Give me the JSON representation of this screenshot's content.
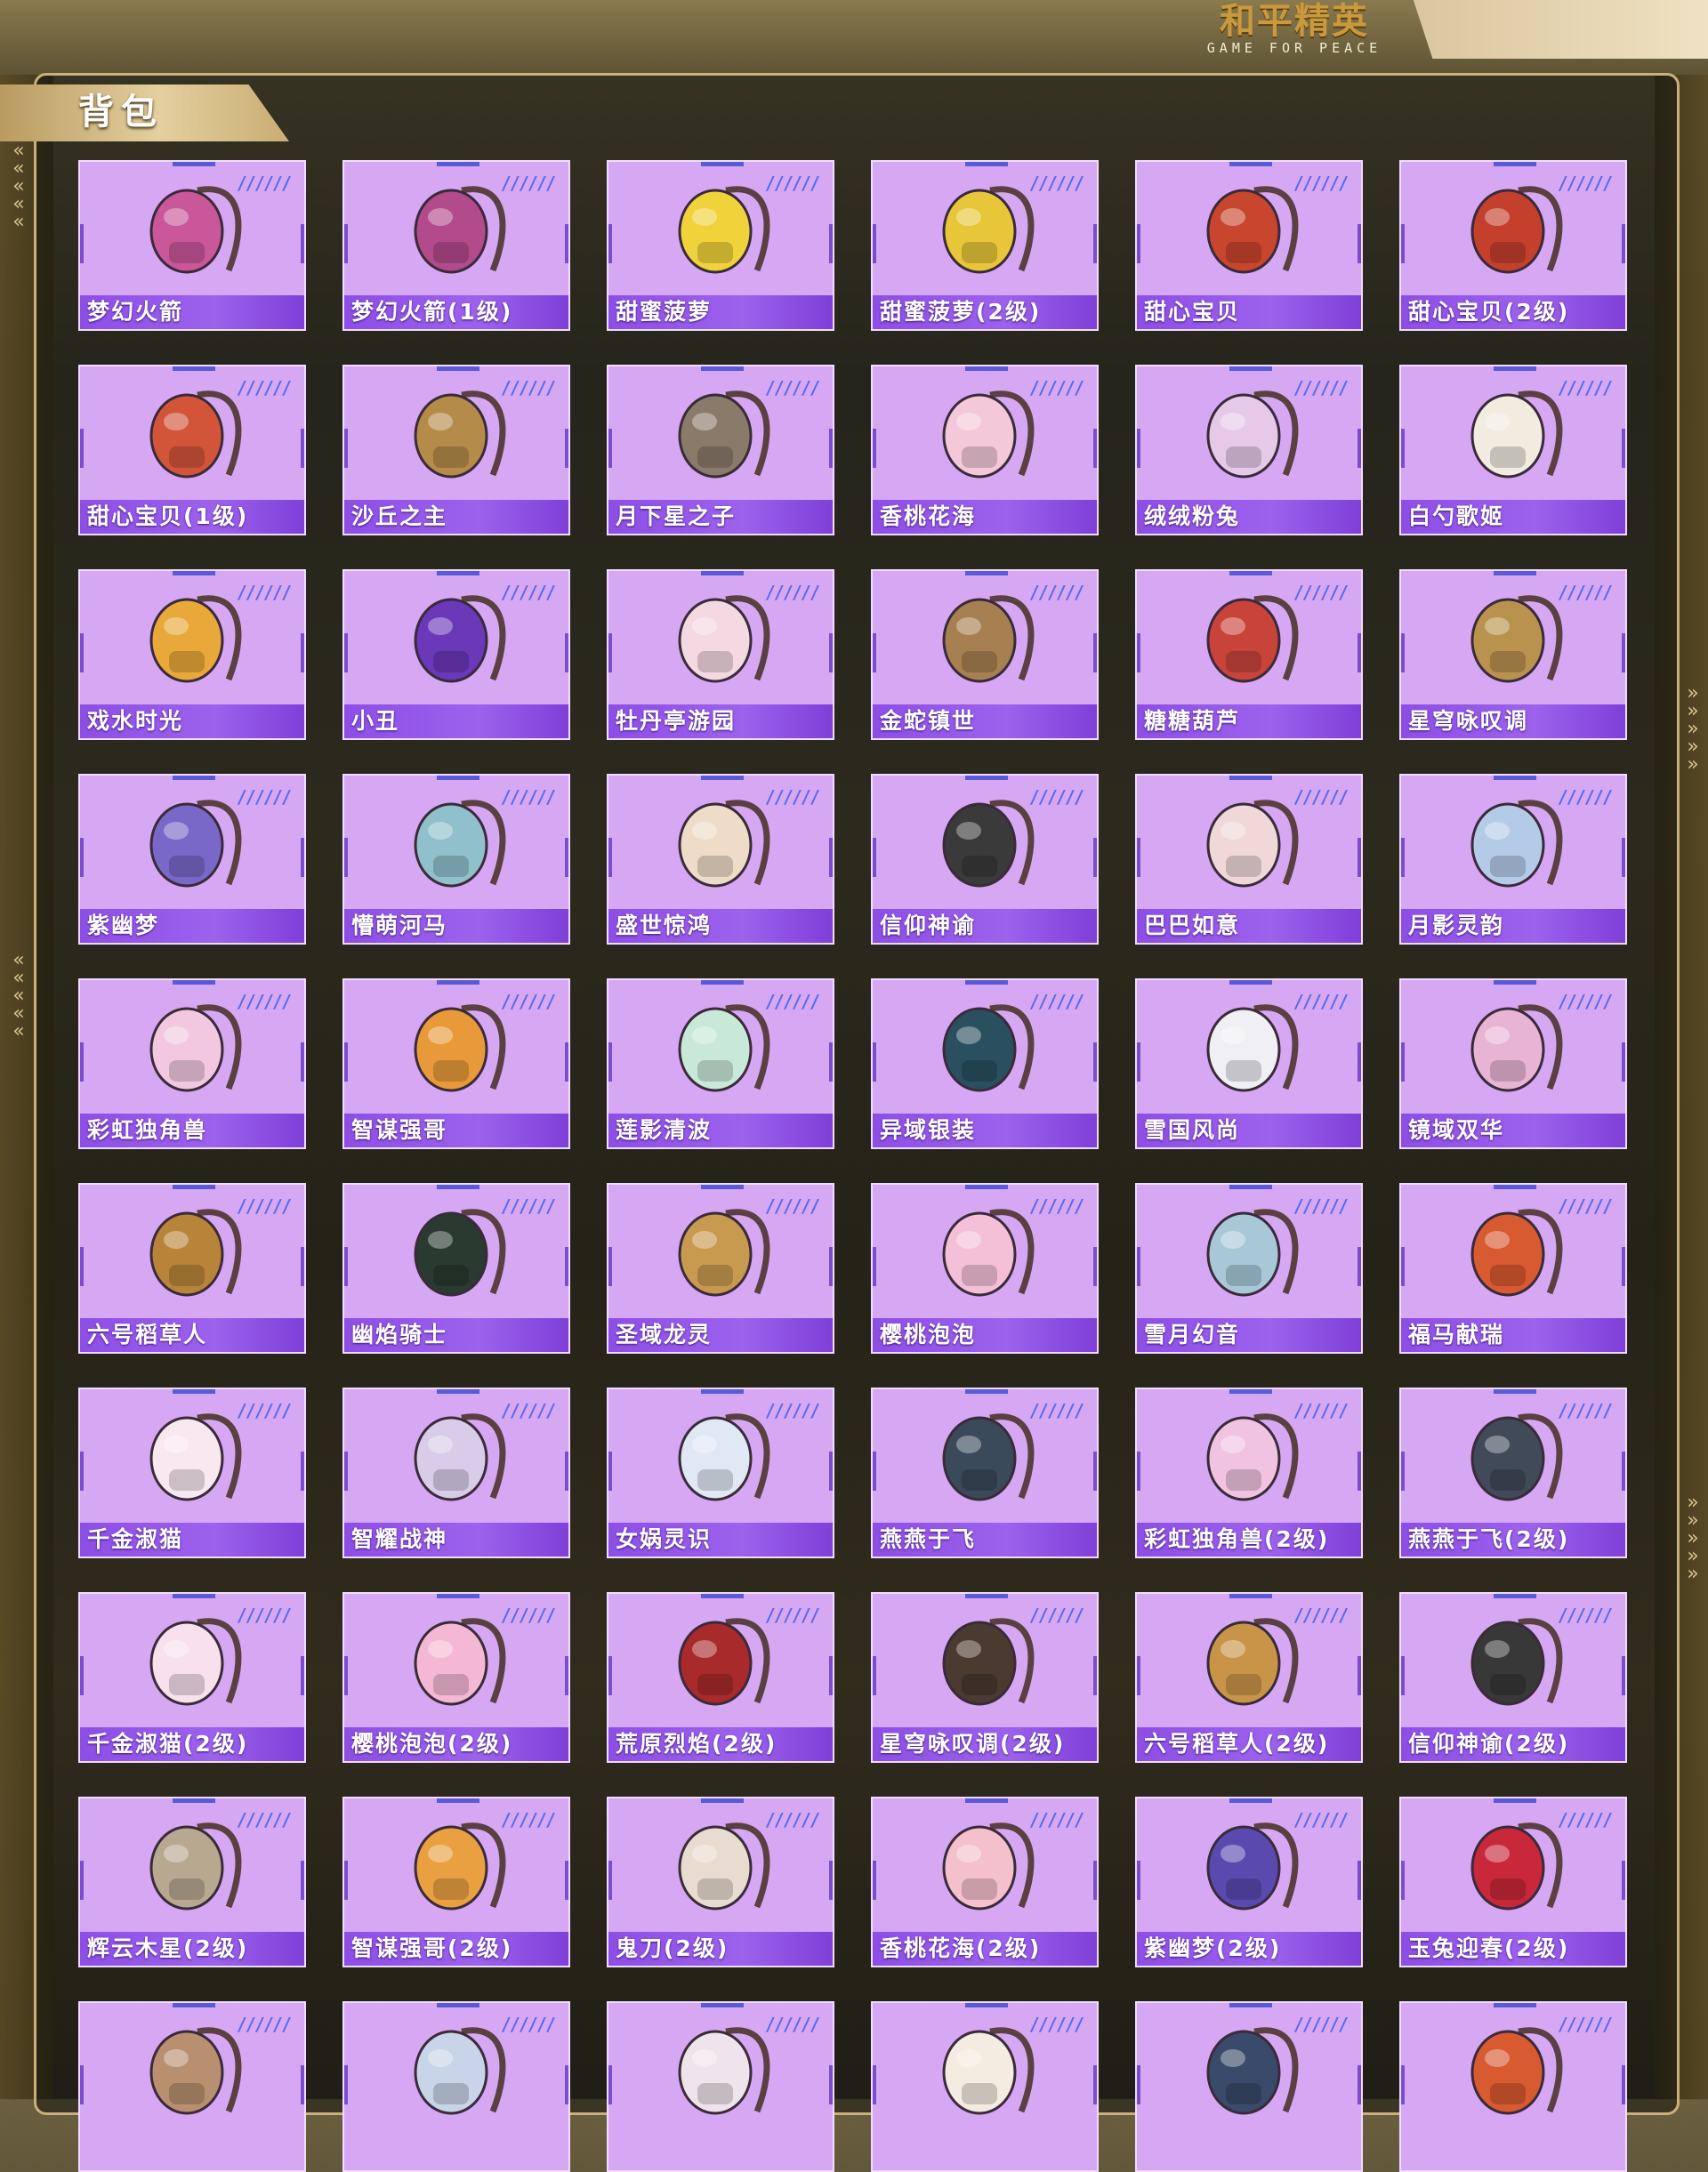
{
  "brand": {
    "title": "和平精英",
    "subtitle": "GAME FOR PEACE"
  },
  "section": {
    "title": "背包"
  },
  "items": [
    {
      "name": "梦幻火箭",
      "icon": "rocket-backpack-icon",
      "color": "#c9579a"
    },
    {
      "name": "梦幻火箭(1级)",
      "icon": "rocket-backpack-icon",
      "color": "#b24a8c"
    },
    {
      "name": "甜蜜菠萝",
      "icon": "pineapple-backpack-icon",
      "color": "#f0d23a"
    },
    {
      "name": "甜蜜菠萝(2级)",
      "icon": "pineapple-backpack-icon",
      "color": "#e8c63a"
    },
    {
      "name": "甜心宝贝",
      "icon": "cake-backpack-icon",
      "color": "#c8452e"
    },
    {
      "name": "甜心宝贝(2级)",
      "icon": "cake-backpack-icon",
      "color": "#c4402c"
    },
    {
      "name": "甜心宝贝(1级)",
      "icon": "cake-backpack-icon",
      "color": "#d2553a"
    },
    {
      "name": "沙丘之主",
      "icon": "scroll-backpack-icon",
      "color": "#b58b4a"
    },
    {
      "name": "月下星之子",
      "icon": "star-backpack-icon",
      "color": "#8a7a6a"
    },
    {
      "name": "香桃花海",
      "icon": "flower-backpack-icon",
      "color": "#f3c8d8"
    },
    {
      "name": "绒绒粉兔",
      "icon": "bunny-backpack-icon",
      "color": "#e6c9e8"
    },
    {
      "name": "白勺歌姬",
      "icon": "bunny-backpack-icon",
      "color": "#f1ebe0"
    },
    {
      "name": "戏水时光",
      "icon": "duck-backpack-icon",
      "color": "#e8a83a"
    },
    {
      "name": "小丑",
      "icon": "jester-backpack-icon",
      "color": "#6a38b8"
    },
    {
      "name": "牡丹亭游园",
      "icon": "purse-backpack-icon",
      "color": "#f4d8e2"
    },
    {
      "name": "金蛇镇世",
      "icon": "snake-backpack-icon",
      "color": "#a68050"
    },
    {
      "name": "糖糖葫芦",
      "icon": "gourd-backpack-icon",
      "color": "#c8443a"
    },
    {
      "name": "星穹咏叹调",
      "icon": "crown-backpack-icon",
      "color": "#b9924e"
    },
    {
      "name": "紫幽梦",
      "icon": "orb-backpack-icon",
      "color": "#7a68c8"
    },
    {
      "name": "懵萌河马",
      "icon": "hippo-backpack-icon",
      "color": "#8fc0cc"
    },
    {
      "name": "盛世惊鸿",
      "icon": "feather-backpack-icon",
      "color": "#efdcc8"
    },
    {
      "name": "信仰神谕",
      "icon": "armor-backpack-icon",
      "color": "#3a3a3a"
    },
    {
      "name": "巴巴如意",
      "icon": "bunny-backpack-icon",
      "color": "#f0d8d8"
    },
    {
      "name": "月影灵韵",
      "icon": "moon-backpack-icon",
      "color": "#b4cbe8"
    },
    {
      "name": "彩虹独角兽",
      "icon": "unicorn-backpack-icon",
      "color": "#f2c8e0"
    },
    {
      "name": "智谋强哥",
      "icon": "bear-backpack-icon",
      "color": "#e89a3a"
    },
    {
      "name": "莲影清波",
      "icon": "lotus-backpack-icon",
      "color": "#c8e8d8"
    },
    {
      "name": "异域银装",
      "icon": "tech-backpack-icon",
      "color": "#2a5060"
    },
    {
      "name": "雪国风尚",
      "icon": "penguin-backpack-icon",
      "color": "#f0f0f4"
    },
    {
      "name": "镜域双华",
      "icon": "heart-backpack-icon",
      "color": "#e8b4d4"
    },
    {
      "name": "六号稻草人",
      "icon": "scarecrow-backpack-icon",
      "color": "#b8843a"
    },
    {
      "name": "幽焰骑士",
      "icon": "knight-backpack-icon",
      "color": "#2a3a30"
    },
    {
      "name": "圣域龙灵",
      "icon": "hourglass-backpack-icon",
      "color": "#c89a50"
    },
    {
      "name": "樱桃泡泡",
      "icon": "bow-backpack-icon",
      "color": "#f4c0d8"
    },
    {
      "name": "雪月幻音",
      "icon": "globe-backpack-icon",
      "color": "#a8c8d8"
    },
    {
      "name": "福马献瑞",
      "icon": "rabbit-backpack-icon",
      "color": "#d85a30"
    },
    {
      "name": "千金淑猫",
      "icon": "cat-backpack-icon",
      "color": "#f8e8f0"
    },
    {
      "name": "智耀战神",
      "icon": "wing-backpack-icon",
      "color": "#d8cce8"
    },
    {
      "name": "女娲灵识",
      "icon": "crystal-backpack-icon",
      "color": "#e0e8f4"
    },
    {
      "name": "燕燕于飞",
      "icon": "swallow-backpack-icon",
      "color": "#3a4a5a"
    },
    {
      "name": "彩虹独角兽(2级)",
      "icon": "unicorn-backpack-icon",
      "color": "#f0c4e0"
    },
    {
      "name": "燕燕于飞(2级)",
      "icon": "swallow-backpack-icon",
      "color": "#404a58"
    },
    {
      "name": "千金淑猫(2级)",
      "icon": "cat-backpack-icon",
      "color": "#f8e0ec"
    },
    {
      "name": "樱桃泡泡(2级)",
      "icon": "bow-backpack-icon",
      "color": "#f4b8d4"
    },
    {
      "name": "荒原烈焰(2级)",
      "icon": "flame-backpack-icon",
      "color": "#a82a2a"
    },
    {
      "name": "星穹咏叹调(2级)",
      "icon": "crown-backpack-icon",
      "color": "#4a3a30"
    },
    {
      "name": "六号稻草人(2级)",
      "icon": "scarecrow-backpack-icon",
      "color": "#c89448"
    },
    {
      "name": "信仰神谕(2级)",
      "icon": "armor-backpack-icon",
      "color": "#383838"
    },
    {
      "name": "辉云木星(2级)",
      "icon": "planet-backpack-icon",
      "color": "#b8a890"
    },
    {
      "name": "智谋强哥(2级)",
      "icon": "bear-backpack-icon",
      "color": "#e8a040"
    },
    {
      "name": "鬼刀(2级)",
      "icon": "blade-backpack-icon",
      "color": "#e8dcd0"
    },
    {
      "name": "香桃花海(2级)",
      "icon": "flower-backpack-icon",
      "color": "#f4c0cc"
    },
    {
      "name": "紫幽梦(2级)",
      "icon": "orb-backpack-icon",
      "color": "#5a4ab0"
    },
    {
      "name": "玉兔迎春(2级)",
      "icon": "classic-backpack-icon",
      "color": "#c8283a"
    },
    {
      "name": "",
      "icon": "deer-backpack-icon",
      "color": "#b89070"
    },
    {
      "name": "",
      "icon": "bunny-backpack-icon",
      "color": "#c8d4e8"
    },
    {
      "name": "",
      "icon": "ghost-backpack-icon",
      "color": "#f0e4ec"
    },
    {
      "name": "",
      "icon": "bunny-backpack-icon",
      "color": "#f4ece0"
    },
    {
      "name": "",
      "icon": "moon-backpack-icon",
      "color": "#3a4a6a"
    },
    {
      "name": "",
      "icon": "rabbit-backpack-icon",
      "color": "#d85a30"
    }
  ]
}
